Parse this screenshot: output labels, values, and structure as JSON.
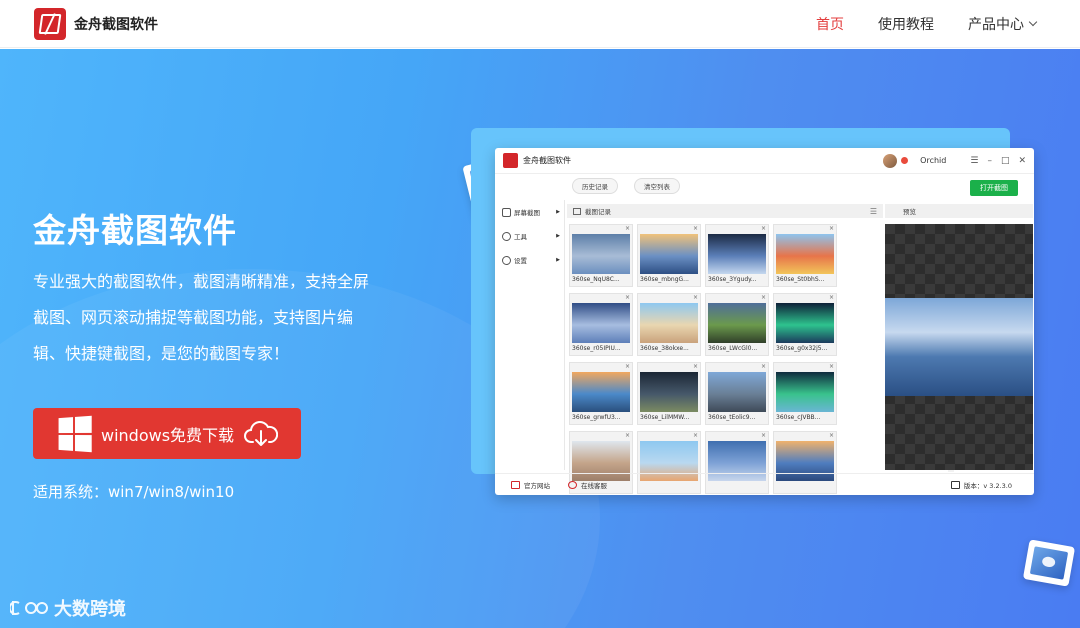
{
  "header": {
    "brand_name": "金舟截图软件",
    "nav": [
      {
        "label": "首页",
        "active": true
      },
      {
        "label": "使用教程",
        "active": false
      },
      {
        "label": "产品中心",
        "active": false
      }
    ]
  },
  "hero": {
    "title": "金舟截图软件",
    "description": "专业强大的截图软件，截图清晰精准，支持全屏截图、网页滚动捕捉等截图功能，支持图片编辑、快捷键截图，是您的截图专家！",
    "download_label": "windows免费下载",
    "system_note": "适用系统：win7/win8/win10"
  },
  "watermark": "大数跨境",
  "app_window": {
    "title": "金舟截图软件",
    "user_name": "Orchid",
    "window_controls": [
      "☰",
      "–",
      "□",
      "✕"
    ],
    "toolbar": {
      "history": "历史记录",
      "clear": "清空列表",
      "open": "打开截图"
    },
    "sidebar": [
      {
        "label": "屏幕截图"
      },
      {
        "label": "工具"
      },
      {
        "label": "设置"
      }
    ],
    "history_header": "截图记录",
    "preview_header": "预览",
    "thumbnails": [
      {
        "caption": "360se_NqU8C...",
        "colors": [
          "#5d7fa8",
          "#a8bcd6",
          "#6b8fbf"
        ]
      },
      {
        "caption": "360se_mbngG...",
        "colors": [
          "#f0c27a",
          "#6b90c4",
          "#2d4f84"
        ]
      },
      {
        "caption": "360se_3Ygudy...",
        "colors": [
          "#1c2a44",
          "#5b7fb8",
          "#c4d7ef"
        ]
      },
      {
        "caption": "360se_St0bhS...",
        "colors": [
          "#8ec4ee",
          "#e7744a",
          "#f2c55a"
        ]
      },
      {
        "caption": "360se_r05IPIU...",
        "colors": [
          "#304d86",
          "#a7bde0",
          "#5e7fb9"
        ]
      },
      {
        "caption": "360se_38okxe...",
        "colors": [
          "#8ec8f0",
          "#e9d6b0",
          "#c9a27c"
        ]
      },
      {
        "caption": "360se_LWcGl0...",
        "colors": [
          "#4f6e99",
          "#6b9a4c",
          "#30402a"
        ]
      },
      {
        "caption": "360se_g0x32j5...",
        "colors": [
          "#0e2038",
          "#2ec38e",
          "#1c3a5c"
        ]
      },
      {
        "caption": "360se_grwfU3...",
        "colors": [
          "#f1a85f",
          "#4b89c9",
          "#2a4f7d"
        ]
      },
      {
        "caption": "360se_LilMMW...",
        "colors": [
          "#1b2735",
          "#46586a",
          "#7b8b62"
        ]
      },
      {
        "caption": "360se_tEolic9...",
        "colors": [
          "#7fa8d7",
          "#6a7f96",
          "#3e4a58"
        ]
      },
      {
        "caption": "360se_cJVBB...",
        "colors": [
          "#0f2b3e",
          "#39c28c",
          "#6ab6d4"
        ]
      },
      {
        "caption": "",
        "colors": [
          "#dfe6ee",
          "#c4a48a",
          "#9d7f6a"
        ]
      },
      {
        "caption": "",
        "colors": [
          "#8ec8f0",
          "#b9d8f0",
          "#e8a56f"
        ]
      },
      {
        "caption": "",
        "colors": [
          "#3f6fb0",
          "#7ea2d6",
          "#c7d6ec"
        ]
      },
      {
        "caption": "",
        "colors": [
          "#f0b26c",
          "#4f7dbf",
          "#2b497d"
        ]
      }
    ],
    "footer": {
      "website": "官方网站",
      "support": "在线客服",
      "version": "版本：v 3.2.3.0"
    }
  }
}
